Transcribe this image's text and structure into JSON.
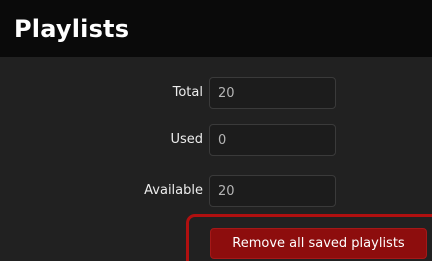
{
  "header": {
    "title": "Playlists"
  },
  "fields": {
    "total": {
      "label": "Total",
      "value": "20"
    },
    "used": {
      "label": "Used",
      "value": "0"
    },
    "available": {
      "label": "Available",
      "value": "20"
    }
  },
  "actions": {
    "remove_all_label": "Remove all saved playlists"
  },
  "colors": {
    "header_bg": "#0a0a0a",
    "panel_bg": "#212121",
    "danger": "#8d0d0d",
    "highlight_border": "#b01010"
  }
}
